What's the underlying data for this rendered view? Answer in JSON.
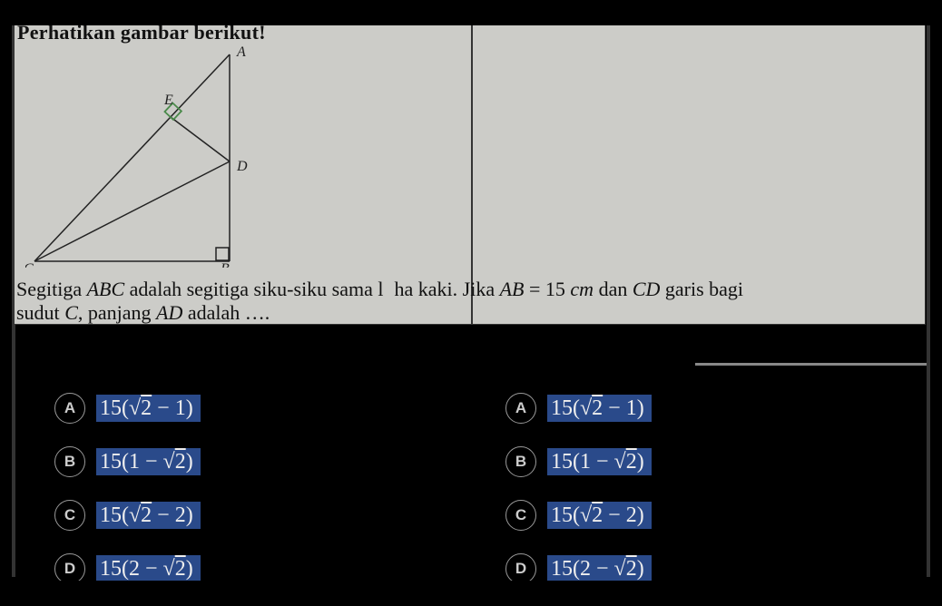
{
  "header": "Perhatikan gambar berikut!",
  "diagram": {
    "labels": {
      "A": "A",
      "B": "B",
      "C": "C",
      "D": "D",
      "E": "E"
    }
  },
  "question_text_1": "Segitiga ",
  "question_var_1": "ABC",
  "question_text_2": " adalah segitiga siku-siku sama l",
  "question_text_2b": "ha kaki. Jika ",
  "question_var_2": "AB",
  "question_text_3": " = 15 ",
  "question_var_3": "cm",
  "question_text_4": " dan ",
  "question_var_4": "CD",
  "question_text_5": " garis bagi",
  "question_text_6": "sudut ",
  "question_var_5": "C",
  "question_text_7": ", panjang ",
  "question_var_6": "AD",
  "question_text_8": " adalah ….",
  "options": {
    "A": {
      "letter": "A",
      "prefix": "15(",
      "sqrt_arg": "2",
      "after_sqrt": " − 1)"
    },
    "B": {
      "letter": "B",
      "prefix": "15(1 − ",
      "sqrt_arg": "2",
      "after_sqrt": ")"
    },
    "C": {
      "letter": "C",
      "prefix": "15(",
      "sqrt_arg": "2",
      "after_sqrt": " − 2) "
    },
    "D": {
      "letter": "D",
      "prefix": "15(2 − ",
      "sqrt_arg": "2",
      "after_sqrt": ")"
    }
  }
}
